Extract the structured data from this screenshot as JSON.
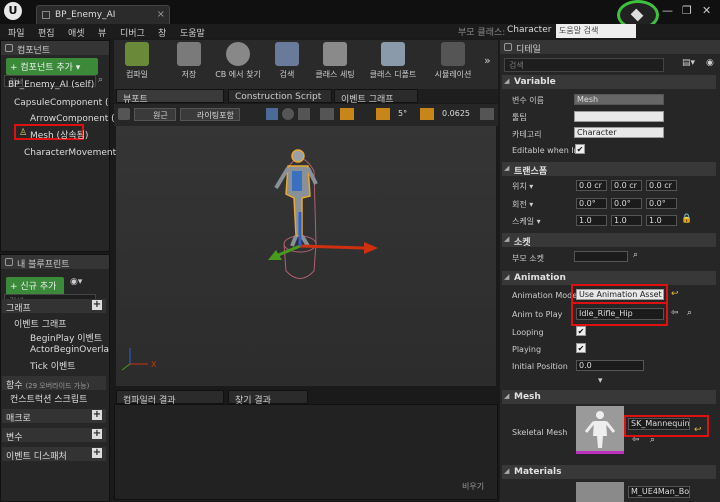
{
  "window": {
    "tab_title": "BP_Enemy_AI"
  },
  "menu": [
    "파일",
    "편집",
    "애셋",
    "뷰",
    "디버그",
    "창",
    "도움말"
  ],
  "parent_class": {
    "label": "부모 클래스:",
    "value": "Character"
  },
  "help_search_placeholder": "도움말 검색",
  "components_panel": {
    "title": "컴포넌트",
    "add_button": "+ 컴포넌트 추가 ▾",
    "search_placeholder": "검색",
    "items": [
      "BP_Enemy_AI (self)",
      "CapsuleComponent (",
      "ArrowComponent (",
      "Mesh (상속됨)",
      "CharacterMovement"
    ]
  },
  "my_blueprint_panel": {
    "title": "내 블루프린트",
    "add_button": "+ 신규 추가 ▾",
    "search_placeholder": "검색",
    "graph_section": "그래프",
    "event_graph": "이벤트 그래프",
    "events": [
      "BeginPlay 이벤트",
      "ActorBeginOverla",
      "Tick 이벤트"
    ],
    "functions_section": "함수",
    "functions_count": "(29 오버라이드 가능)",
    "construction_script": "컨스트럭션 스크립트",
    "macros": "매크로",
    "variables": "변수",
    "event_dispatchers": "이벤트 디스패처"
  },
  "toolbar": {
    "items": [
      {
        "label": "컴파일",
        "icon": "compile-icon"
      },
      {
        "label": "저장",
        "icon": "save-icon"
      },
      {
        "label": "CB 에서 찾기",
        "icon": "find-in-cb-icon"
      },
      {
        "label": "검색",
        "icon": "search-icon"
      },
      {
        "label": "클래스 세팅",
        "icon": "class-settings-icon"
      },
      {
        "label": "클래스 디폴트",
        "icon": "class-defaults-icon"
      },
      {
        "label": "시뮬레이션",
        "icon": "simulation-icon"
      }
    ]
  },
  "editor_tabs": [
    "뷰포트",
    "Construction Script",
    "이벤트 그래프"
  ],
  "viewport_bar": {
    "perspective": "원근",
    "lighting": "라이팅포함",
    "snap_angle": "5°",
    "scale_snap": "0.0625"
  },
  "bottom_tabs": [
    "컴파일러 결과",
    "찾기 결과"
  ],
  "bottom_clear": "비우기",
  "details": {
    "title": "디테일",
    "search_placeholder": "검색",
    "variable_section": "Variable",
    "var_name_label": "변수 이름",
    "var_name_value": "Mesh",
    "tooltip_label": "툴팁",
    "category_label": "카테고리",
    "category_value": "Character",
    "editable_label": "Editable when In",
    "transform_section": "트랜스폼",
    "location_label": "위치 ▾",
    "rotation_label": "회전 ▾",
    "scale_label": "스케일 ▾",
    "location": [
      "0.0 cr",
      "0.0 cr",
      "0.0 cr"
    ],
    "rotation": [
      "0.0°",
      "0.0°",
      "0.0°"
    ],
    "scale": [
      "1.0",
      "1.0",
      "1.0"
    ],
    "sockets_section": "소켓",
    "parent_socket_label": "부모 소켓",
    "animation_section": "Animation",
    "anim_mode_label": "Animation Mode",
    "anim_mode_value": "Use Animation Asset",
    "anim_to_play_label": "Anim to Play",
    "anim_to_play_value": "Idle_Rifle_Hip",
    "looping_label": "Looping",
    "playing_label": "Playing",
    "initial_position_label": "Initial Position",
    "initial_position_value": "0.0",
    "mesh_section": "Mesh",
    "skeletal_mesh_label": "Skeletal Mesh",
    "skeletal_mesh_value": "SK_Mannequin",
    "materials_section": "Materials",
    "material_value": "M_UE4Man_Bo"
  }
}
